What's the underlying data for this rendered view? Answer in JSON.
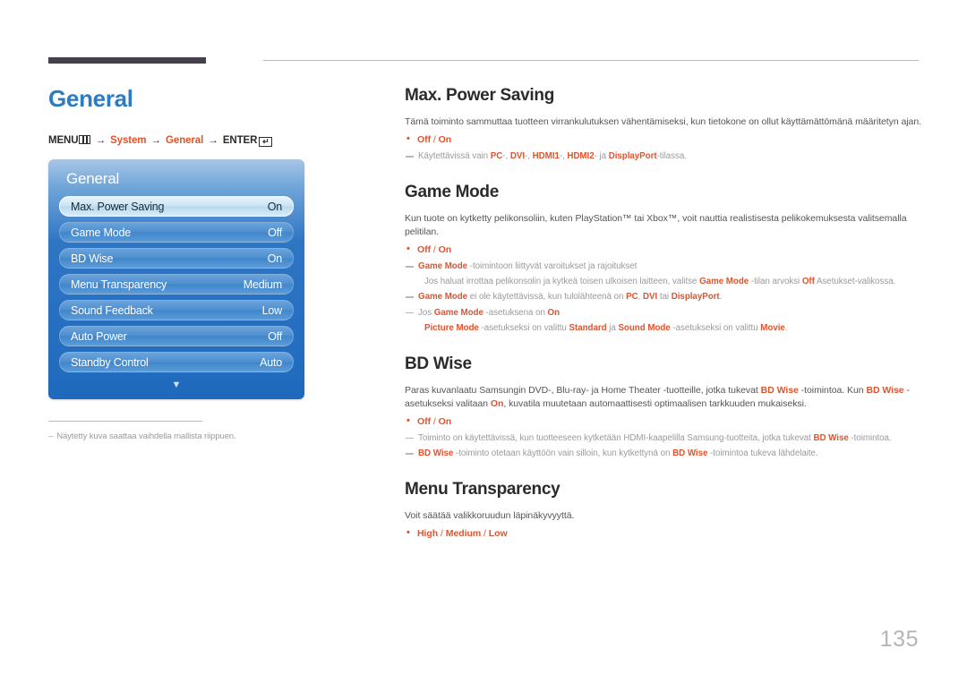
{
  "page": {
    "number": "135",
    "title": "General"
  },
  "breadcrumb": {
    "menu_label": "MENU",
    "menu_icon": "menu-grid-icon",
    "arrow": "→",
    "step1": "System",
    "step2": "General",
    "enter_label": "ENTER",
    "enter_icon": "enter-key-icon",
    "enter_glyph": "↵"
  },
  "osd": {
    "title": "General",
    "rows": [
      {
        "label": "Max. Power Saving",
        "value": "On",
        "selected": true
      },
      {
        "label": "Game Mode",
        "value": "Off",
        "selected": false
      },
      {
        "label": "BD Wise",
        "value": "On",
        "selected": false
      },
      {
        "label": "Menu Transparency",
        "value": "Medium",
        "selected": false
      },
      {
        "label": "Sound Feedback",
        "value": "Low",
        "selected": false
      },
      {
        "label": "Auto Power",
        "value": "Off",
        "selected": false
      },
      {
        "label": "Standby Control",
        "value": "Auto",
        "selected": false
      }
    ],
    "scroll_down_icon": "chevron-down-icon",
    "scroll_down_glyph": "▼"
  },
  "left_footnote": {
    "dash": "–",
    "text": "Näytetty kuva saattaa vaihdella mallista riippuen."
  },
  "sections": [
    {
      "id": "max-power-saving",
      "title": "Max. Power Saving",
      "body": "Tämä toiminto sammuttaa tuotteen virrankulutuksen vähentämiseksi, kun tietokone on ollut käyttämättömänä määritetyn ajan.",
      "option": "Off / On",
      "notes": [
        "Käytettävissä vain PC-, DVI-, HDMI1-, HDMI2- ja DisplayPort-tilassa."
      ]
    },
    {
      "id": "game-mode",
      "title": "Game Mode",
      "body": "Kun tuote on kytketty pelikonsoliin, kuten PlayStation™ tai Xbox™, voit nauttia realistisesta pelikokemuksesta valitsemalla pelitilan.",
      "option": "Off / On",
      "notes": [
        "Game Mode -toimintoon liittyvät varoitukset ja rajoitukset",
        "Jos haluat irrottaa pelikonsolin ja kytkeä toisen ulkoisen laitteen, valitse Game Mode -tilan arvoksi Off Asetukset-valikossa.",
        "Game Mode ei ole käytettävissä, kun tulolähteenä on PC, DVI tai DisplayPort.",
        "Jos Game Mode -asetuksena on On",
        "Picture Mode -asetukseksi on valittu Standard ja Sound Mode -asetukseksi on valittu Movie."
      ]
    },
    {
      "id": "bd-wise",
      "title": "BD Wise",
      "body": "Paras kuvanlaatu Samsungin DVD-, Blu-ray- ja Home Theater -tuotteille, jotka tukevat BD Wise -toimintoa. Kun BD Wise -asetukseksi valitaan On, kuvatila muutetaan automaattisesti optimaalisen tarkkuuden mukaiseksi.",
      "option": "Off / On",
      "notes": [
        "Toiminto on käytettävissä, kun tuotteeseen kytketään HDMI-kaapelilla Samsung-tuotteita, jotka tukevat BD Wise -toimintoa.",
        "BD Wise -toiminto otetaan käyttöön vain silloin, kun kytkettynä on BD Wise -toimintoa tukeva lähdelaite."
      ]
    },
    {
      "id": "menu-transparency",
      "title": "Menu Transparency",
      "body": "Voit säätää valikkoruudun läpinäkyvyyttä.",
      "option": "High / Medium / Low",
      "notes": []
    }
  ],
  "colors": {
    "accent_orange": "#e0542c",
    "title_blue": "#2b7cc0",
    "osd_blue": "#2f76c4",
    "rule_dark": "#45404c",
    "muted_gray": "#9a9aa0"
  }
}
